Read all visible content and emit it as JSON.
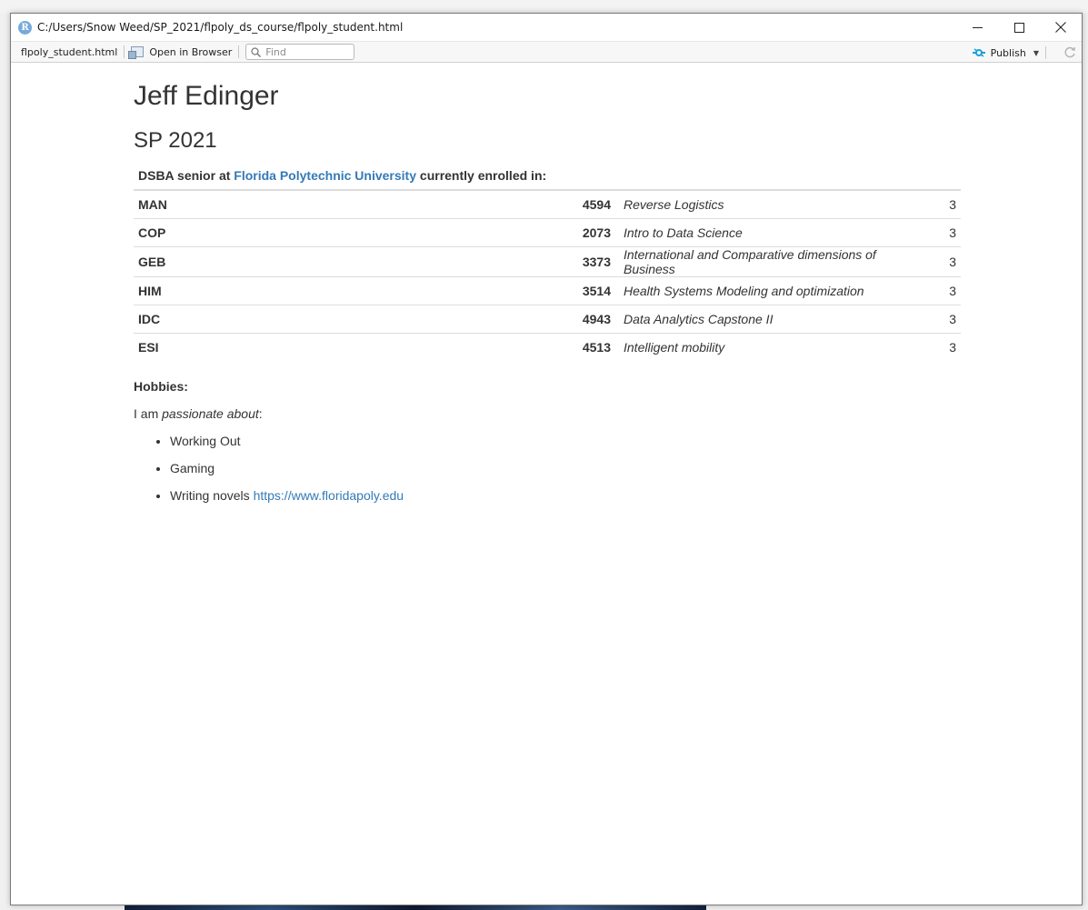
{
  "window": {
    "title": "C:/Users/Snow Weed/SP_2021/flpoly_ds_course/flpoly_student.html",
    "app_icon_letter": "R"
  },
  "toolbar": {
    "file_name": "flpoly_student.html",
    "open_in_browser": "Open in Browser",
    "find_placeholder": "Find",
    "publish_label": "Publish"
  },
  "page": {
    "heading": "Jeff Edinger",
    "term": "SP 2021",
    "intro": {
      "prefix": "DSBA senior at",
      "link_text": "Florida Polytechnic University",
      "suffix": "currently enrolled in:"
    },
    "courses": [
      {
        "dept": "MAN",
        "number": "4594",
        "title": "Reverse Logistics",
        "credits": "3"
      },
      {
        "dept": "COP",
        "number": "2073",
        "title": "Intro to Data Science",
        "credits": "3"
      },
      {
        "dept": "GEB",
        "number": "3373",
        "title": "International and Comparative dimensions of Business",
        "credits": "3"
      },
      {
        "dept": "HIM",
        "number": "3514",
        "title": "Health Systems Modeling and optimization",
        "credits": "3"
      },
      {
        "dept": "IDC",
        "number": "4943",
        "title": "Data Analytics Capstone II",
        "credits": "3"
      },
      {
        "dept": "ESI",
        "number": "4513",
        "title": "Intelligent mobility",
        "credits": "3"
      }
    ],
    "hobbies_heading": "Hobbies:",
    "passion": {
      "prefix": "I am",
      "emphasis": "passionate about",
      "suffix": ":"
    },
    "hobbies": [
      {
        "text": "Working Out"
      },
      {
        "text": "Gaming"
      },
      {
        "text": "Writing novels",
        "link": "https://www.floridapoly.edu"
      }
    ]
  },
  "colors": {
    "link": "#337ab7",
    "text": "#333333",
    "accent": "#75aadb"
  }
}
